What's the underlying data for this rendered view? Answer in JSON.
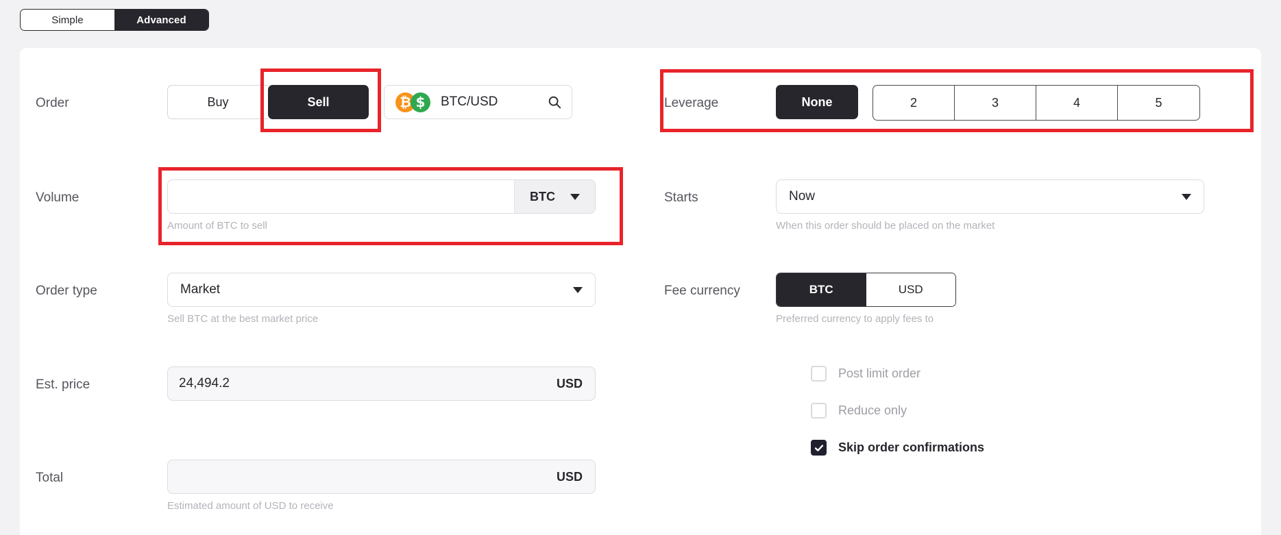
{
  "mode_toggle": {
    "options": [
      {
        "label": "Simple",
        "active": false
      },
      {
        "label": "Advanced",
        "active": true
      }
    ]
  },
  "form": {
    "order": {
      "label": "Order",
      "side_buttons": [
        {
          "label": "Buy",
          "active": false
        },
        {
          "label": "Sell",
          "active": true
        }
      ],
      "pair": {
        "name": "BTC/USD",
        "base_symbol": "₿",
        "quote_symbol": "$",
        "base_color": "#f7931a",
        "quote_color": "#2fa84f",
        "search_icon": "search-icon"
      }
    },
    "leverage": {
      "label": "Leverage",
      "none_label": "None",
      "none_active": true,
      "options": [
        "2",
        "3",
        "4",
        "5"
      ]
    },
    "volume": {
      "label": "Volume",
      "value": "",
      "placeholder": "",
      "unit": "BTC",
      "helper": "Amount of BTC to sell"
    },
    "starts": {
      "label": "Starts",
      "value": "Now",
      "helper": "When this order should be placed on the market"
    },
    "order_type": {
      "label": "Order type",
      "value": "Market",
      "helper": "Sell BTC at the best market price"
    },
    "fee_currency": {
      "label": "Fee currency",
      "options": [
        {
          "label": "BTC",
          "active": true
        },
        {
          "label": "USD",
          "active": false
        }
      ],
      "helper": "Preferred currency to apply fees to"
    },
    "est_price": {
      "label": "Est. price",
      "value": "24,494.2",
      "unit": "USD"
    },
    "total": {
      "label": "Total",
      "value": "",
      "placeholder": "",
      "unit": "USD",
      "helper": "Estimated amount of USD to receive"
    },
    "checkboxes": [
      {
        "label": "Post limit order",
        "checked": false
      },
      {
        "label": "Reduce only",
        "checked": false
      },
      {
        "label": "Skip order confirmations",
        "checked": true
      }
    ]
  },
  "annotations": {
    "color": "#e8242a",
    "boxes": [
      {
        "name": "sell-button-highlight"
      },
      {
        "name": "leverage-row-highlight"
      },
      {
        "name": "volume-field-highlight"
      }
    ]
  }
}
